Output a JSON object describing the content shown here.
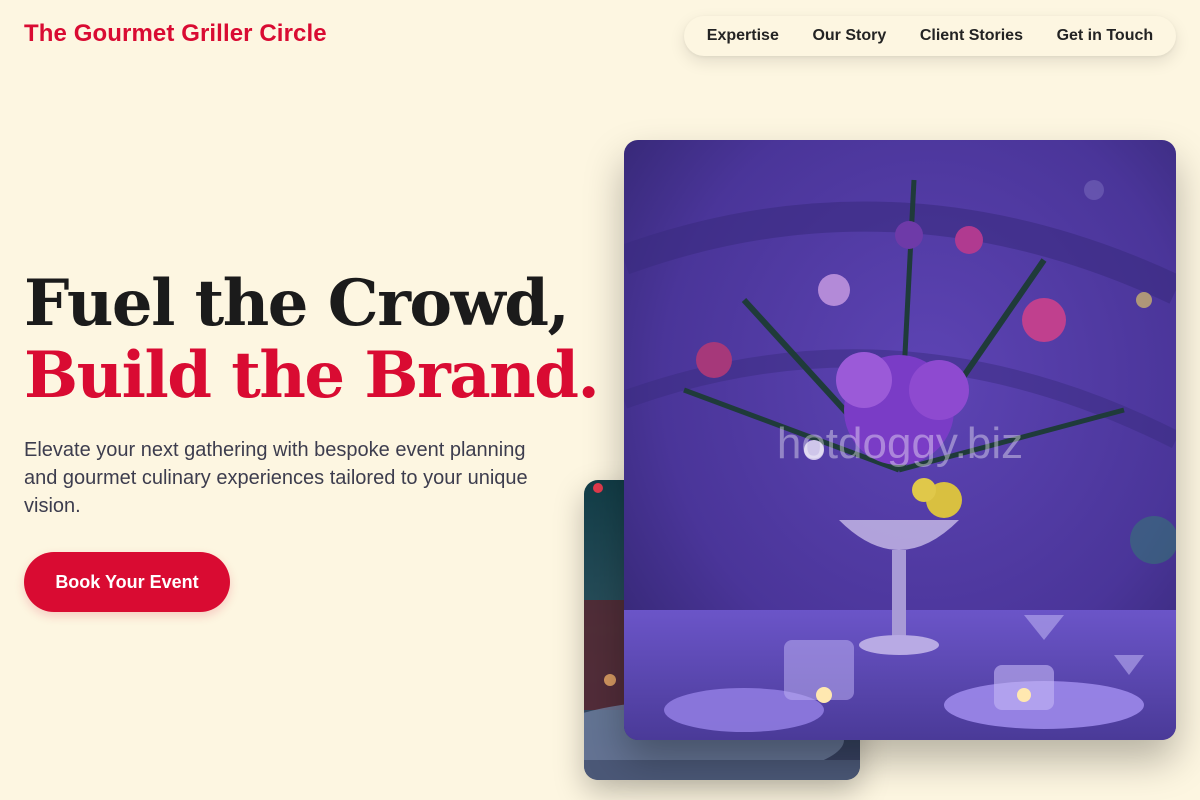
{
  "header": {
    "brand": "The Gourmet Griller Circle",
    "nav": [
      "Expertise",
      "Our Story",
      "Client Stories",
      "Get in Touch"
    ]
  },
  "hero": {
    "headline_line1": "Fuel the Crowd,",
    "headline_line2": "Build the Brand.",
    "subtitle": "Elevate your next gathering with bespoke event planning and gourmet culinary experiences tailored to your unique vision.",
    "cta_label": "Book Your Event"
  },
  "images": {
    "main_watermark": "hotdoggy.biz",
    "main_alt": "Purple floral centerpiece on an event table",
    "secondary_alt": "Event table setting"
  },
  "colors": {
    "accent": "#d90b32",
    "background": "#fdf6e1",
    "text_dark": "#1b1b1b",
    "text_body": "#3d3d4e"
  }
}
